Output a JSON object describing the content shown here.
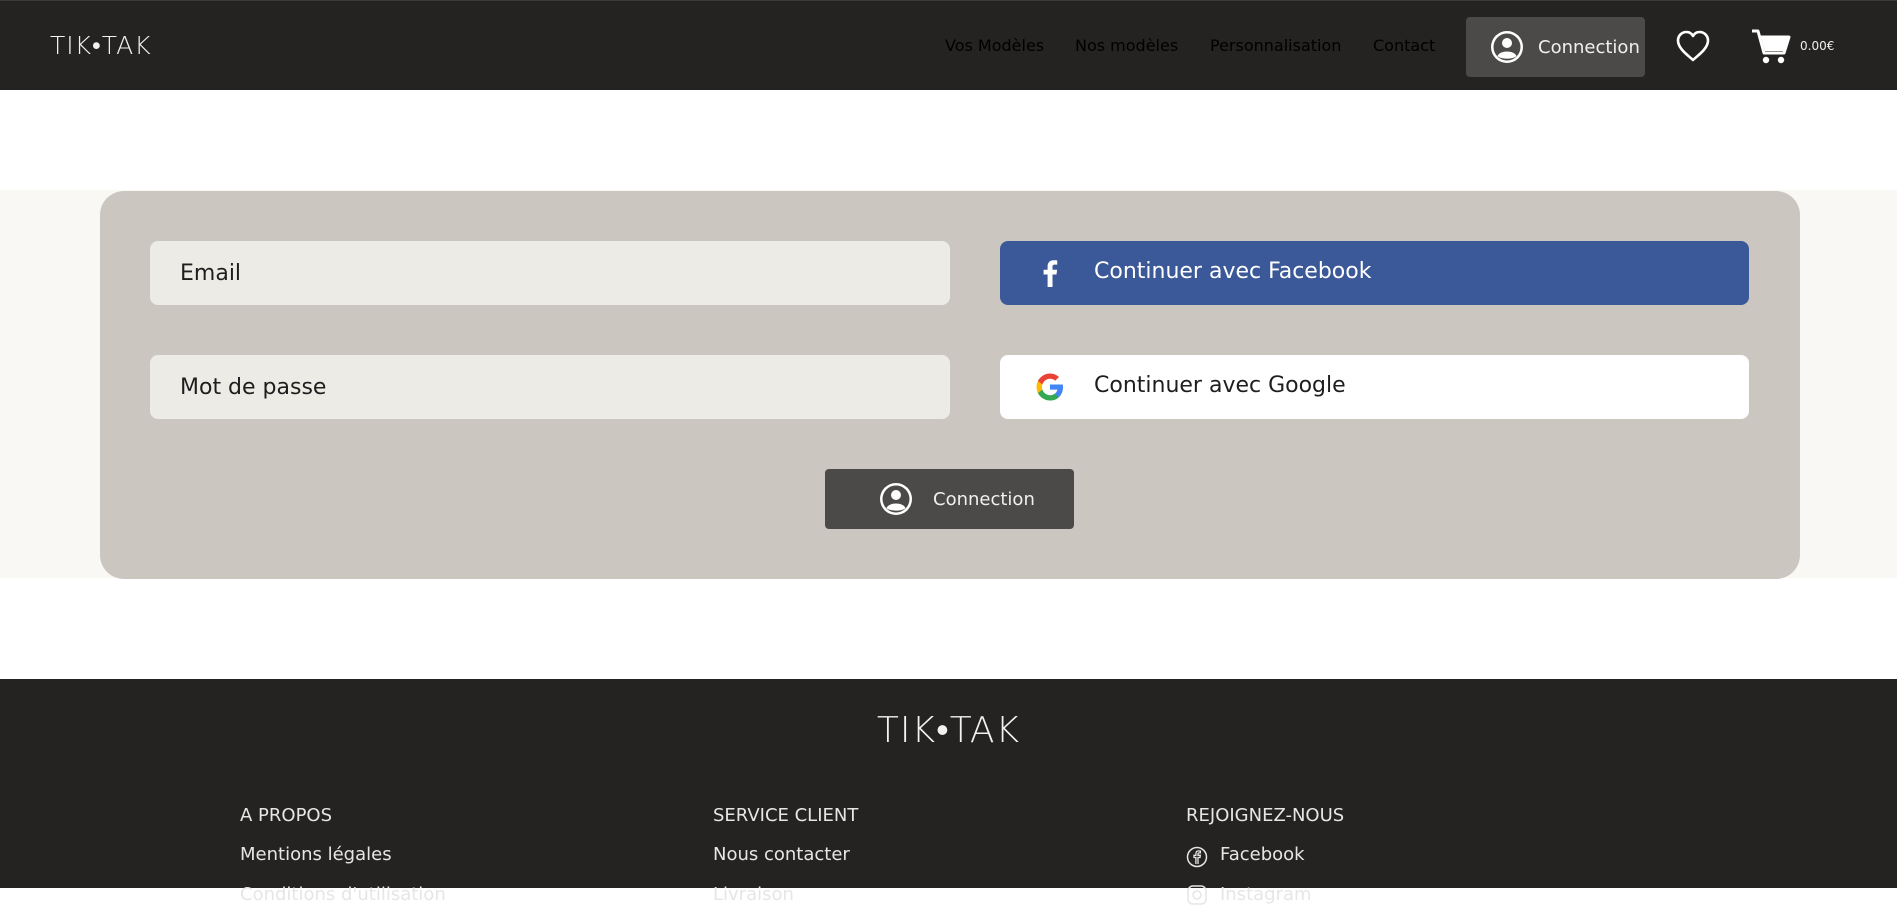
{
  "header": {
    "logo": "TIK•TAK",
    "nav": [
      {
        "label": "Vos Modèles"
      },
      {
        "label": "Nos modèles"
      },
      {
        "label": "Personnalisation"
      },
      {
        "label": "Contact"
      }
    ],
    "connection_label": "Connection",
    "cart_total": "0.00€"
  },
  "login": {
    "email_placeholder": "Email",
    "password_placeholder": "Mot de passe",
    "facebook_label": "Continuer avec Facebook",
    "google_label": "Continuer avec Google",
    "submit_label": "Connection"
  },
  "footer": {
    "logo": "TIK•TAK",
    "columns": [
      {
        "heading": "A PROPOS",
        "links": [
          "Mentions légales",
          "Conditions d'utilisation"
        ]
      },
      {
        "heading": "SERVICE CLIENT",
        "links": [
          "Nous contacter",
          "Livraison"
        ]
      },
      {
        "heading": "REJOIGNEZ-NOUS",
        "links": [
          "Facebook",
          "Instagram"
        ]
      }
    ]
  },
  "colors": {
    "header_bg": "#242321",
    "card_bg": "#cbc7c0",
    "facebook_blue": "#3b5998",
    "button_dark": "#4b4a48"
  },
  "icons": {
    "user": "user-circle-icon",
    "heart": "heart-icon",
    "cart": "cart-icon",
    "facebook": "facebook-icon",
    "google": "google-icon"
  }
}
